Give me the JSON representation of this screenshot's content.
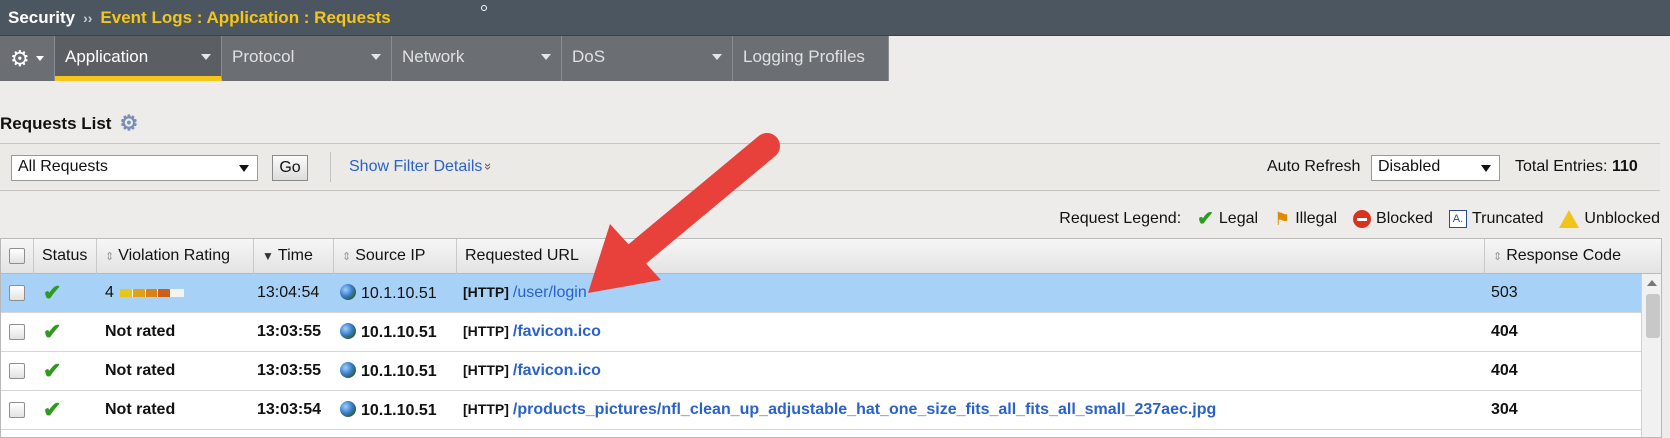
{
  "breadcrumb": {
    "root": "Security",
    "separator": "››",
    "path": "Event Logs : Application : Requests"
  },
  "tabs": [
    {
      "label": "Application",
      "active": true,
      "dropdown": true
    },
    {
      "label": "Protocol",
      "active": false,
      "dropdown": true
    },
    {
      "label": "Network",
      "active": false,
      "dropdown": true
    },
    {
      "label": "DoS",
      "active": false,
      "dropdown": true
    },
    {
      "label": "Logging Profiles",
      "active": false,
      "dropdown": false
    }
  ],
  "list": {
    "title": "Requests List"
  },
  "filter": {
    "selected": "All Requests",
    "go_label": "Go",
    "details_link": "Show Filter Details",
    "details_glyph": "»",
    "auto_refresh_label": "Auto Refresh",
    "auto_refresh_value": "Disabled",
    "total_label": "Total Entries:",
    "total_value": "110"
  },
  "legend": {
    "label": "Request Legend:",
    "items": {
      "legal": "Legal",
      "illegal": "Illegal",
      "blocked": "Blocked",
      "truncated": "Truncated",
      "unblocked": "Unblocked"
    },
    "truncated_glyph": "A."
  },
  "columns": {
    "status": "Status",
    "violation_rating": "Violation Rating",
    "time": "Time",
    "source_ip": "Source IP",
    "requested_url": "Requested URL",
    "response_code": "Response Code"
  },
  "rows": [
    {
      "rating": "4",
      "rating_level": 0.72,
      "time": "13:04:54",
      "ip": "10.1.10.51",
      "proto": "[HTTP]",
      "url": "/user/login",
      "code": "503"
    },
    {
      "rating": "Not rated",
      "time": "13:03:55",
      "ip": "10.1.10.51",
      "proto": "[HTTP]",
      "url": "/favicon.ico",
      "code": "404"
    },
    {
      "rating": "Not rated",
      "time": "13:03:55",
      "ip": "10.1.10.51",
      "proto": "[HTTP]",
      "url": "/favicon.ico",
      "code": "404"
    },
    {
      "rating": "Not rated",
      "time": "13:03:54",
      "ip": "10.1.10.51",
      "proto": "[HTTP]",
      "url": "/products_pictures/nfl_clean_up_adjustable_hat_one_size_fits_all_fits_all_small_237aec.jpg",
      "code": "304"
    }
  ],
  "colors": {
    "accent": "#f5c518",
    "selected_row": "#a8d1f7",
    "link": "#2a62c9",
    "arrow": "#e8403a"
  }
}
